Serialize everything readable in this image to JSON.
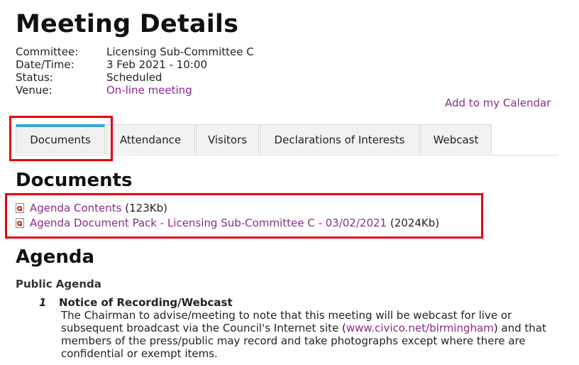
{
  "page": {
    "title": "Meeting Details"
  },
  "meeting": {
    "committee_label": "Committee:",
    "committee_value": "Licensing Sub-Committee C",
    "datetime_label": "Date/Time:",
    "datetime_value": "3 Feb 2021 - 10:00",
    "status_label": "Status:",
    "status_value": "Scheduled",
    "venue_label": "Venue:",
    "venue_value": "On-line meeting"
  },
  "calendar_link": "Add to my Calendar",
  "tabs": [
    {
      "label": "Documents",
      "active": true
    },
    {
      "label": "Attendance"
    },
    {
      "label": "Visitors"
    },
    {
      "label": "Declarations of Interests"
    },
    {
      "label": "Webcast"
    }
  ],
  "documents": {
    "heading": "Documents",
    "items": [
      {
        "title": "Agenda Contents",
        "size": "(123Kb)",
        "icon": "pdf-icon"
      },
      {
        "title": "Agenda Document Pack - Licensing Sub-Committee C - 03/02/2021",
        "size": "(2024Kb)",
        "icon": "pdf-icon"
      }
    ]
  },
  "agenda": {
    "heading": "Agenda",
    "subheading": "Public Agenda",
    "items": [
      {
        "number": "1",
        "title": "Notice of Recording/Webcast",
        "desc_before": "The Chairman to advise/meeting to note that this meeting will be webcast for live or subsequent broadcast via the Council's Internet site (",
        "desc_link": "www.civico.net/birmingham",
        "desc_after": ") and that members of the press/public may record and take photographs except where there are confidential or exempt items."
      }
    ]
  },
  "colors": {
    "link": "#8a2b8a",
    "tab_accent": "#3aa7c9",
    "highlight": "#e6000f"
  }
}
